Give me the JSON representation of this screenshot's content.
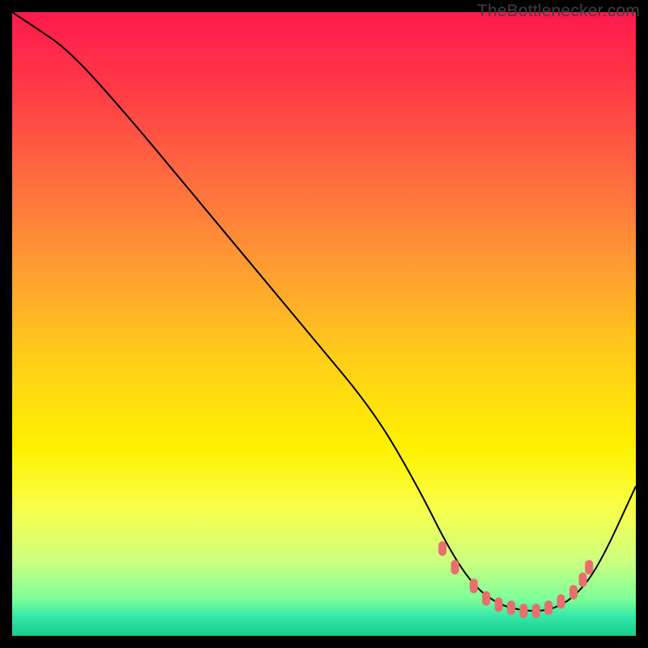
{
  "watermark": "TheBottlenecker.com",
  "chart_data": {
    "type": "line",
    "title": "",
    "xlabel": "",
    "ylabel": "",
    "xlim": [
      0,
      100
    ],
    "ylim": [
      0,
      100
    ],
    "axes_visible": false,
    "grid": false,
    "background": {
      "type": "vertical-gradient",
      "stops": [
        {
          "offset": 0.0,
          "color": "#ff1a4d"
        },
        {
          "offset": 0.1,
          "color": "#ff3348"
        },
        {
          "offset": 0.25,
          "color": "#ff6640"
        },
        {
          "offset": 0.4,
          "color": "#ff9933"
        },
        {
          "offset": 0.55,
          "color": "#ffcc1a"
        },
        {
          "offset": 0.7,
          "color": "#fff200"
        },
        {
          "offset": 0.8,
          "color": "#f7ff4d"
        },
        {
          "offset": 0.88,
          "color": "#ccff80"
        },
        {
          "offset": 0.94,
          "color": "#80ff99"
        },
        {
          "offset": 0.97,
          "color": "#33e6a6"
        },
        {
          "offset": 1.0,
          "color": "#1acc8c"
        }
      ]
    },
    "series": [
      {
        "name": "bottleneck-curve",
        "color": "#000000",
        "stroke_width": 2,
        "x": [
          0,
          3,
          9,
          18,
          28,
          38,
          48,
          58,
          65,
          70,
          74,
          78,
          82,
          86,
          90,
          94,
          100
        ],
        "y": [
          100,
          98,
          94,
          84,
          72,
          60,
          48,
          36,
          24,
          14,
          8,
          5,
          4,
          4,
          6,
          11,
          24
        ]
      }
    ],
    "markers": [
      {
        "name": "flat-region-dots",
        "shape": "rounded-rect",
        "color": "#e96f6f",
        "points": [
          {
            "x": 69,
            "y": 14
          },
          {
            "x": 71,
            "y": 11
          },
          {
            "x": 74,
            "y": 8
          },
          {
            "x": 76,
            "y": 6
          },
          {
            "x": 78,
            "y": 5
          },
          {
            "x": 80,
            "y": 4.5
          },
          {
            "x": 82,
            "y": 4
          },
          {
            "x": 84,
            "y": 4
          },
          {
            "x": 86,
            "y": 4.5
          },
          {
            "x": 88,
            "y": 5.5
          },
          {
            "x": 90,
            "y": 7
          },
          {
            "x": 91.5,
            "y": 9
          },
          {
            "x": 92.5,
            "y": 11
          }
        ]
      }
    ]
  }
}
